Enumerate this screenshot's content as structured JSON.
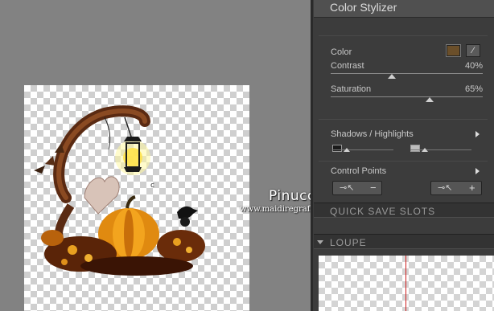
{
  "panel": {
    "title": "Color Stylizer",
    "color_label": "Color",
    "color_value": "#6b4f2a",
    "contrast": {
      "label": "Contrast",
      "value_text": "40%",
      "value": 40
    },
    "saturation": {
      "label": "Saturation",
      "value_text": "65%",
      "value": 65
    },
    "shadows_highlights_label": "Shadows / Highlights",
    "control_points_label": "Control Points",
    "control_point_minus": "−",
    "control_point_plus": "+",
    "quick_save_label": "QUICK SAVE SLOTS",
    "loupe_label": "LOUPE"
  },
  "watermark": {
    "name": "Pinuccia",
    "url": "www.maidiregrafica.eu"
  },
  "colors": {
    "panel_bg": "#3c3c3c",
    "canvas_bg": "#828282",
    "loupe_line": "#d02020"
  }
}
